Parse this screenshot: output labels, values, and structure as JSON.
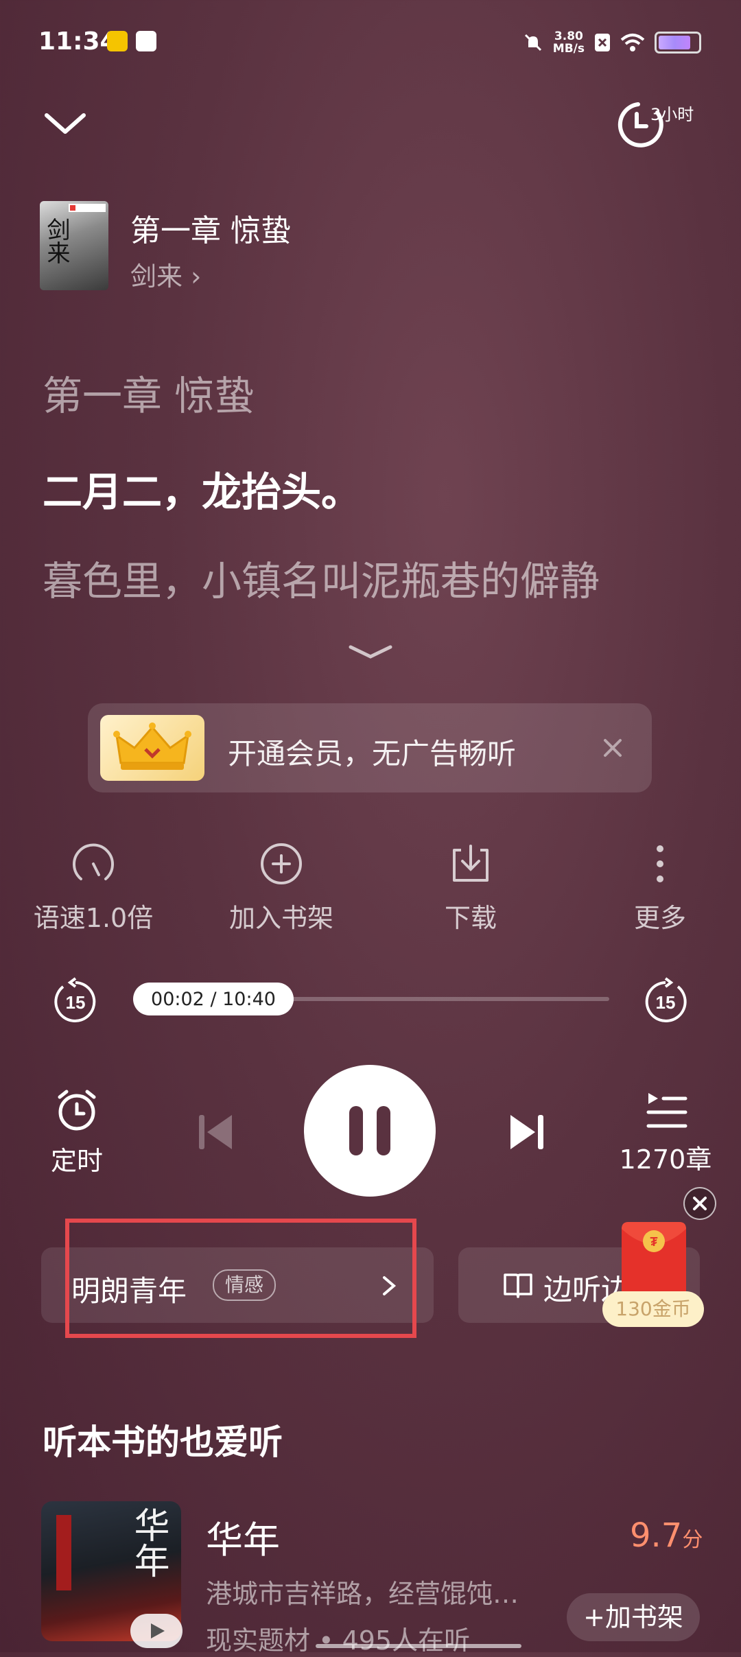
{
  "status_bar": {
    "time": "11:34",
    "net_speed_value": "3.80",
    "net_speed_unit": "MB/s"
  },
  "top": {
    "sleep_timer_label": "3小时"
  },
  "book": {
    "chapter_title": "第一章 惊蛰",
    "book_name": "剑来",
    "book_link_arrow": "›",
    "cover_text": "剑来"
  },
  "text": {
    "chapter_heading": "第一章 惊蛰",
    "current_line": "二月二，龙抬头。",
    "next_line": "暮色里，小镇名叫泥瓶巷的僻静"
  },
  "vip_banner": {
    "text": "开通会员，无广告畅听"
  },
  "actions": [
    {
      "label": "语速1.0倍",
      "icon": "speed-gauge-icon"
    },
    {
      "label": "加入书架",
      "icon": "add-circle-icon"
    },
    {
      "label": "下载",
      "icon": "download-icon"
    },
    {
      "label": "更多",
      "icon": "more-vertical-icon"
    }
  ],
  "player": {
    "progress_label": "00:02 / 10:40",
    "progress_fraction": 0.003,
    "rewind_seconds": "15",
    "forward_seconds": "15",
    "timer_label": "定时",
    "chapters_label": "1270章"
  },
  "voice": {
    "name": "明朗青年",
    "tag": "情感"
  },
  "read_along": {
    "label": "边听边"
  },
  "reward": {
    "coins": "130金币"
  },
  "recommend": {
    "title": "听本书的也爱听",
    "items": [
      {
        "name": "华年",
        "score": "9.7",
        "score_unit": "分",
        "desc": "港城市吉祥路，经营馄饨…",
        "meta": "现实题材 • 495人在听",
        "cover_text": "华年",
        "add_label": "+加书架"
      }
    ]
  },
  "colors": {
    "background": "#5a3240",
    "accent_score": "#ff8f6e",
    "highlight": "#e5484d"
  }
}
